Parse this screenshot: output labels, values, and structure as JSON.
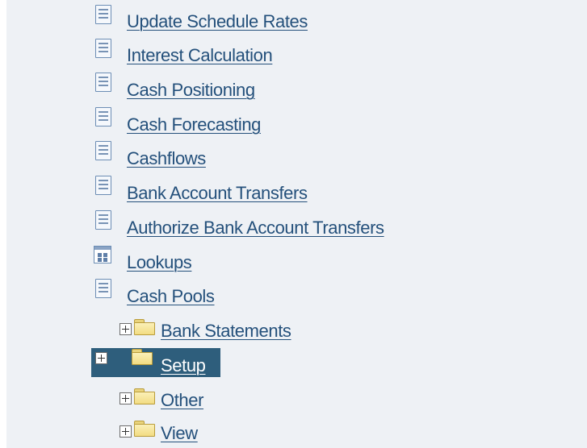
{
  "tree": {
    "items": [
      {
        "label": "Update Schedule Rates",
        "icon": "document-icon"
      },
      {
        "label": "Interest Calculation",
        "icon": "document-icon"
      },
      {
        "label": "Cash Positioning",
        "icon": "document-icon"
      },
      {
        "label": "Cash Forecasting",
        "icon": "document-icon"
      },
      {
        "label": "Cashflows",
        "icon": "document-icon"
      },
      {
        "label": "Bank Account Transfers",
        "icon": "document-icon"
      },
      {
        "label": "Authorize Bank Account Transfers",
        "icon": "document-icon"
      },
      {
        "label": "Lookups",
        "icon": "lookup-icon"
      },
      {
        "label": "Cash Pools",
        "icon": "document-icon"
      }
    ],
    "folders": [
      {
        "label": "Bank Statements",
        "icon": "folder-icon",
        "expand_icon": "plus-icon",
        "selected": false
      },
      {
        "label": "Setup",
        "icon": "folder-icon",
        "expand_icon": "plus-icon",
        "selected": true
      },
      {
        "label": "Other",
        "icon": "folder-icon",
        "expand_icon": "plus-icon",
        "selected": false
      },
      {
        "label": "View",
        "icon": "folder-icon",
        "expand_icon": "plus-icon",
        "selected": false
      }
    ]
  },
  "colors": {
    "link": "#24507b",
    "selected_background": "#2e5e7c",
    "panel_background": "#eef1f5"
  }
}
